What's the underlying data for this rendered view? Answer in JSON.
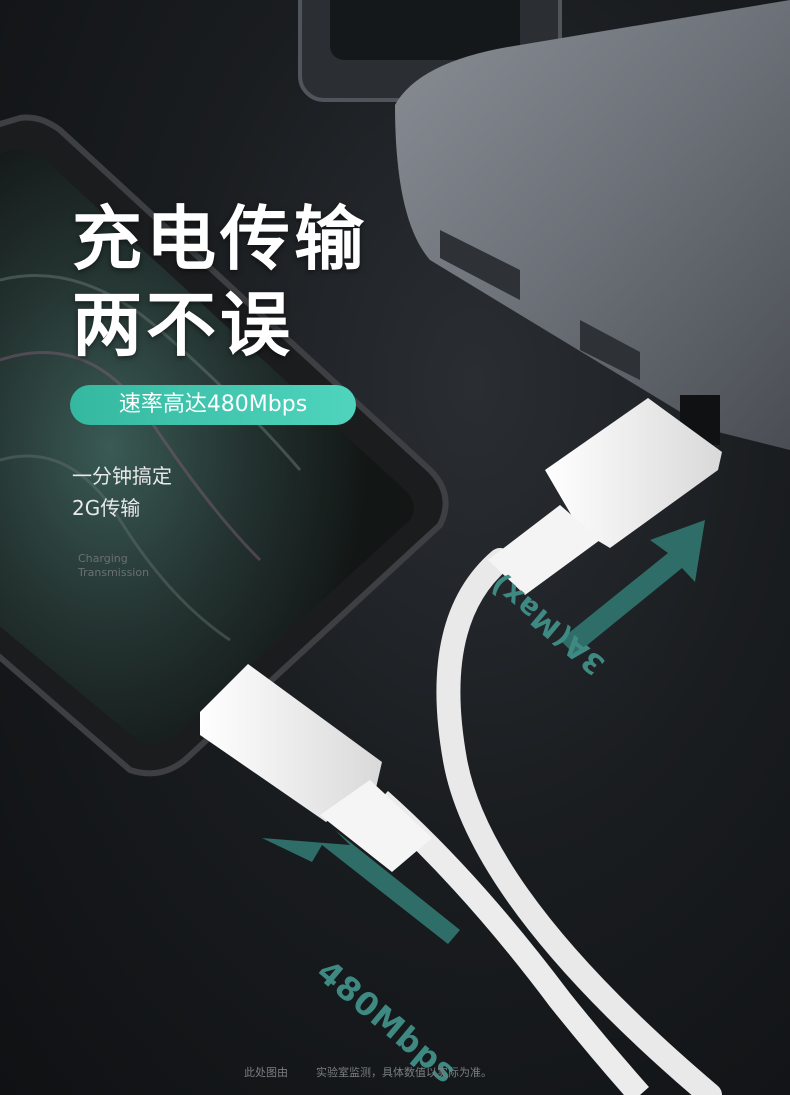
{
  "headline": {
    "line1": "充电传输",
    "line2": "两不误"
  },
  "badge": {
    "text": "速率高达480Mbps"
  },
  "subtitle": {
    "line1": "一分钟搞定",
    "line2": "2G传输"
  },
  "faint_caption": {
    "line1": "Charging",
    "line2": "Transmission"
  },
  "arrows": {
    "upper_label": "3A(Max)",
    "lower_label": "480Mbps"
  },
  "footnote": {
    "part1": "此处图由",
    "part2": "实验室监测，具体数值以实际为准。"
  },
  "colors": {
    "accent_teal": "#35b8a0",
    "arrow_teal": "#3e8a83",
    "cable_white": "#f2f2f2"
  }
}
